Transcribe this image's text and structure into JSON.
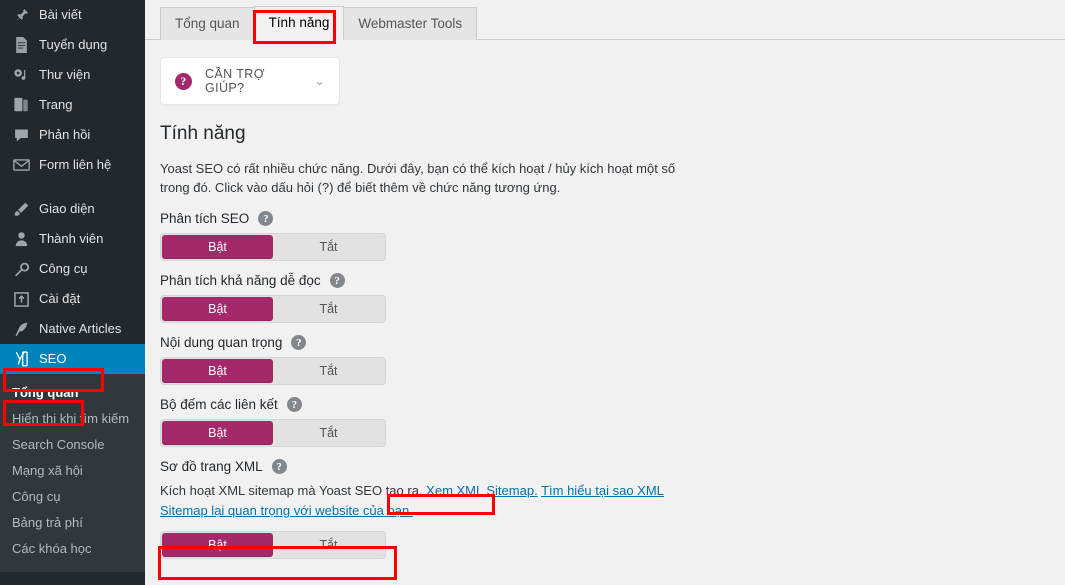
{
  "sidebar": {
    "items": [
      {
        "label": "Bài viết",
        "icon": "pin-icon"
      },
      {
        "label": "Tuyển dụng",
        "icon": "document-icon"
      },
      {
        "label": "Thư viện",
        "icon": "media-icon"
      },
      {
        "label": "Trang",
        "icon": "page-icon"
      },
      {
        "label": "Phản hồi",
        "icon": "comment-icon"
      },
      {
        "label": "Form liên hệ",
        "icon": "envelope-icon"
      }
    ],
    "items2": [
      {
        "label": "Giao diện",
        "icon": "brush-icon"
      },
      {
        "label": "Thành viên",
        "icon": "user-icon"
      },
      {
        "label": "Công cụ",
        "icon": "wrench-icon"
      },
      {
        "label": "Cài đặt",
        "icon": "settings-icon"
      },
      {
        "label": "Native Articles",
        "icon": "feather-icon"
      }
    ],
    "active": {
      "label": "SEO",
      "icon": "yoast-logo-icon"
    },
    "submenu": [
      {
        "label": "Tổng quan",
        "current": true
      },
      {
        "label": "Hiển thị khi tìm kiếm",
        "current": false
      },
      {
        "label": "Search Console",
        "current": false
      },
      {
        "label": "Mạng xã hội",
        "current": false
      },
      {
        "label": "Công cụ",
        "current": false
      },
      {
        "label": "Bảng trả phí",
        "current": false
      },
      {
        "label": "Các khóa học",
        "current": false
      }
    ]
  },
  "tabs": [
    {
      "label": "Tổng quan",
      "active": false
    },
    {
      "label": "Tính năng",
      "active": true
    },
    {
      "label": "Webmaster Tools",
      "active": false
    }
  ],
  "help": {
    "badge": "?",
    "label": "CẦN TRỢ GIÚP?",
    "chevron": "⌄"
  },
  "content": {
    "title": "Tính năng",
    "description": "Yoast SEO có rất nhiều chức năng. Dưới đây, bạn có thể kích hoạt / hủy kích hoạt một số trong đó. Click vào dấu hỏi (?) để biết thêm về chức năng tương ứng.",
    "qmark": "?",
    "toggle_on": "Bật",
    "toggle_off": "Tắt",
    "features": [
      {
        "label": "Phân tích SEO",
        "state": "on"
      },
      {
        "label": "Phân tích khả năng dễ đọc",
        "state": "on"
      },
      {
        "label": "Nội dung quan trọng",
        "state": "on"
      },
      {
        "label": "Bộ đếm các liên kết",
        "state": "on"
      }
    ],
    "sitemap": {
      "label": "Sơ đồ trang XML",
      "note_before": "Kích hoạt XML sitemap mà Yoast SEO tạo ra.",
      "link1": "Xem XML Sitemap.",
      "link2": "Tìm hiểu tại sao XML Sitemap lại quan trọng với website của bạn.",
      "state": "on"
    }
  },
  "colors": {
    "sidebar_bg": "#23282d",
    "submenu_bg": "#32373c",
    "active_blue": "#0085ba",
    "toggle_on": "#a4286a",
    "link": "#0073aa",
    "annotation_red": "#fe0000"
  }
}
